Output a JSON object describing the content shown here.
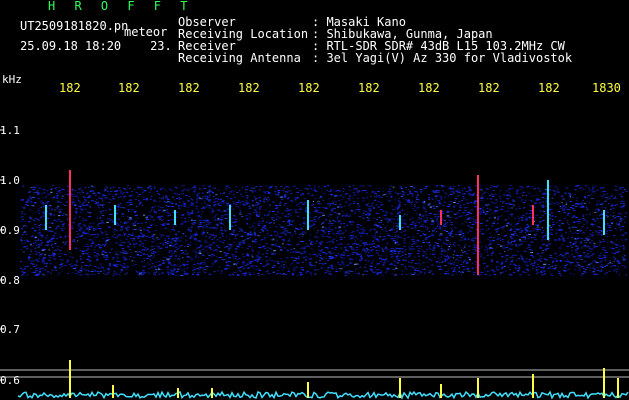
{
  "header": {
    "brand": "H R O F F T",
    "filename": "UT2509181820.pn",
    "filename_suffix": "meteor",
    "datetime": "25.09.18 18:20",
    "datetime_extra": "23."
  },
  "info": [
    {
      "key": "Observer",
      "value": ": Masaki Kano"
    },
    {
      "key": "Receiving Location",
      "value": ": Shibukawa, Gunma, Japan"
    },
    {
      "key": "Receiver",
      "value": ": RTL-SDR SDR# 43dB L15 103.2MHz CW"
    },
    {
      "key": "Receiving Antenna",
      "value": ": 3el Yagi(V) Az 330 for Vladivostok"
    }
  ],
  "axis": {
    "unit": "kHz",
    "y_ticks": [
      "1.1",
      "1.0",
      "0.9",
      "0.8",
      "0.7",
      "0.6"
    ],
    "x_ticks": [
      "182",
      "182",
      "182",
      "182",
      "182",
      "182",
      "182",
      "182",
      "182",
      "1830"
    ]
  },
  "colors": {
    "background": "#000000",
    "brand": "#2cff5a",
    "tick_x": "#ffff40",
    "noise": "#1a2cff",
    "trace": "#40e0ff",
    "spike": "#ffff40"
  }
}
